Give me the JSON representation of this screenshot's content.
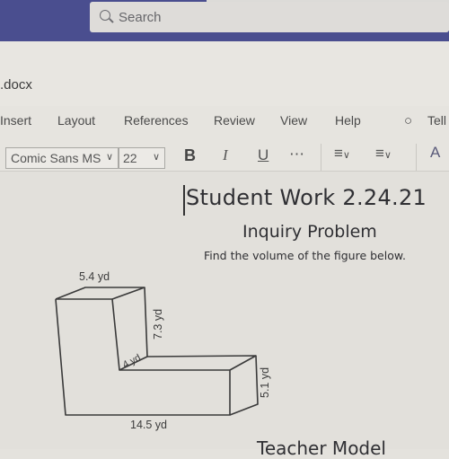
{
  "titlebar": {
    "search": {
      "icon": "search-icon",
      "placeholder": "Search"
    }
  },
  "file": {
    "name": ".docx"
  },
  "ribbon": {
    "tabs": [
      {
        "label": "Insert"
      },
      {
        "label": "Layout"
      },
      {
        "label": "References"
      },
      {
        "label": "Review"
      },
      {
        "label": "View"
      },
      {
        "label": "Help"
      }
    ],
    "tell_me": {
      "icon": "lightbulb-icon",
      "label": "Tell"
    },
    "font_name": "Comic Sans MS",
    "font_size": "22",
    "bold": "B",
    "italic": "I",
    "underline": "U",
    "more": "⋯",
    "bullets_icon": "bullet-list-icon",
    "align_icon": "align-icon",
    "styles_icon": "styles-icon"
  },
  "document": {
    "title": "Student Work 2.24.21",
    "subtitle": "Inquiry Problem",
    "instructions": "Find the volume of the figure below.",
    "figure": {
      "labels": {
        "top_width": "5.4 yd",
        "tall_height": "7.3 yd",
        "depth": "4 yd",
        "short_height": "5.1 yd",
        "bottom_length": "14.5 yd"
      }
    },
    "next_heading": "Teacher Model"
  }
}
